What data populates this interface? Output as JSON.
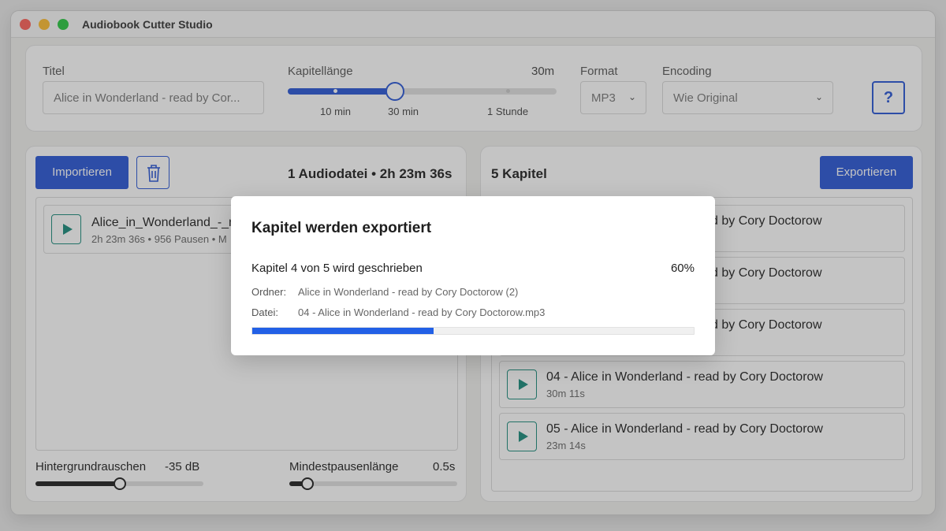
{
  "window": {
    "title": "Audiobook Cutter Studio"
  },
  "settings": {
    "title_label": "Titel",
    "title_value": "Alice in Wonderland - read by Cor...",
    "chapter_length_label": "Kapitellänge",
    "chapter_length_value": "30m",
    "chapter_length_position": 0.4,
    "chapter_length_ticks": [
      "10 min",
      "30 min",
      "1 Stunde"
    ],
    "format_label": "Format",
    "format_value": "MP3",
    "encoding_label": "Encoding",
    "encoding_value": "Wie Original",
    "help_label": "?"
  },
  "import_panel": {
    "import_button": "Importieren",
    "summary": "1 Audiodatei • 2h 23m 36s",
    "files": [
      {
        "name": "Alice_in_Wonderland_-_re",
        "meta": "2h 23m 36s • 956 Pausen • M"
      }
    ],
    "noise_label": "Hintergrundrauschen",
    "noise_value": "-35 dB",
    "noise_position": 0.5,
    "min_pause_label": "Mindestpausenlänge",
    "min_pause_value": "0.5s",
    "min_pause_position": 0.11
  },
  "chapters_panel": {
    "heading": "5 Kapitel",
    "export_button": "Exportieren",
    "chapters": [
      {
        "title": "d by Cory Doctorow",
        "duration": ""
      },
      {
        "title": "d by Cory Doctorow",
        "duration": ""
      },
      {
        "title": "d by Cory Doctorow",
        "duration": ""
      },
      {
        "title": "04 - Alice in Wonderland - read by Cory Doctorow",
        "duration": "30m 11s"
      },
      {
        "title": "05 - Alice in Wonderland - read by Cory Doctorow",
        "duration": "23m 14s"
      }
    ]
  },
  "export_dialog": {
    "title": "Kapitel werden exportiert",
    "status": "Kapitel 4 von 5 wird geschrieben",
    "percent_label": "60%",
    "folder_label": "Ordner:",
    "folder_value": "Alice in Wonderland - read by Cory Doctorow (2)",
    "file_label": "Datei:",
    "file_value": "04 - Alice in Wonderland - read by Cory Doctorow.mp3",
    "progress_fraction": 0.41
  },
  "colors": {
    "accent": "#2855d6",
    "play": "#178a7a",
    "progress": "#2260e6"
  }
}
